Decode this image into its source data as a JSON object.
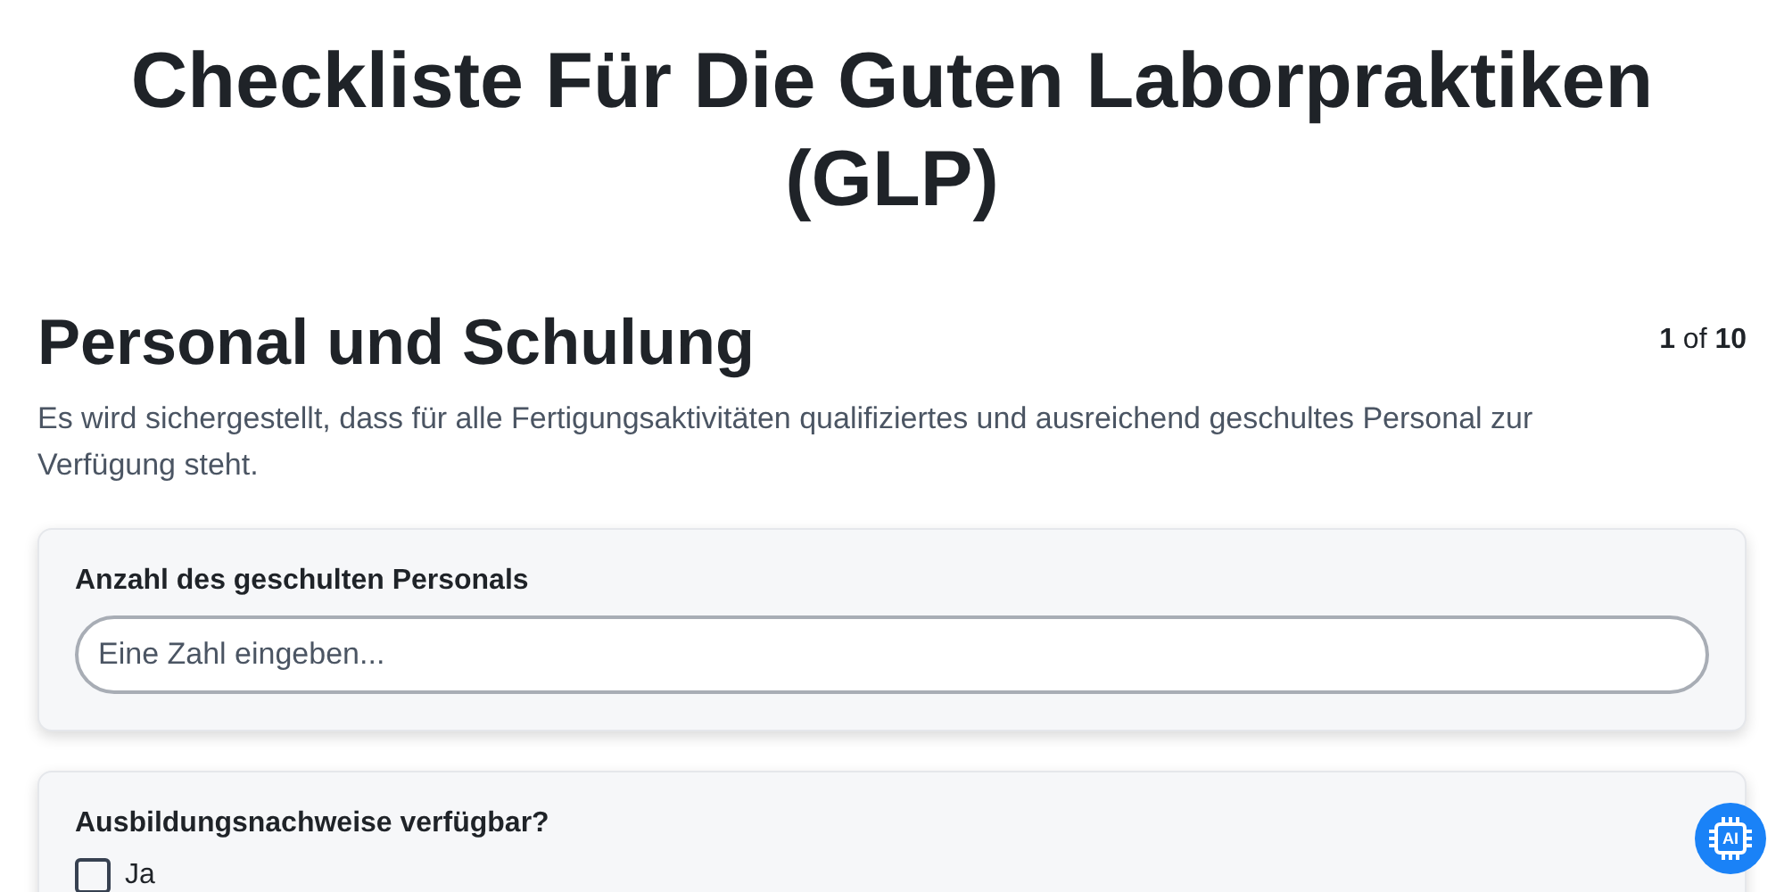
{
  "title": "Checkliste Für Die Guten Laborpraktiken (GLP)",
  "section": {
    "heading": "Personal und Schulung",
    "page": "1",
    "of": "of",
    "total": "10",
    "description": "Es wird sichergestellt, dass für alle Fertigungsaktivitäten qualifiziertes und ausreichend geschultes Personal zur Verfügung steht."
  },
  "questions": [
    {
      "kind": "number",
      "label": "Anzahl des geschulten Personals",
      "placeholder": "Eine Zahl eingeben..."
    },
    {
      "kind": "checkbox",
      "label": "Ausbildungsnachweise verfügbar?",
      "options": [
        {
          "label": "Ja",
          "checked": false
        }
      ]
    }
  ],
  "ai_button": {
    "label": "AI"
  }
}
